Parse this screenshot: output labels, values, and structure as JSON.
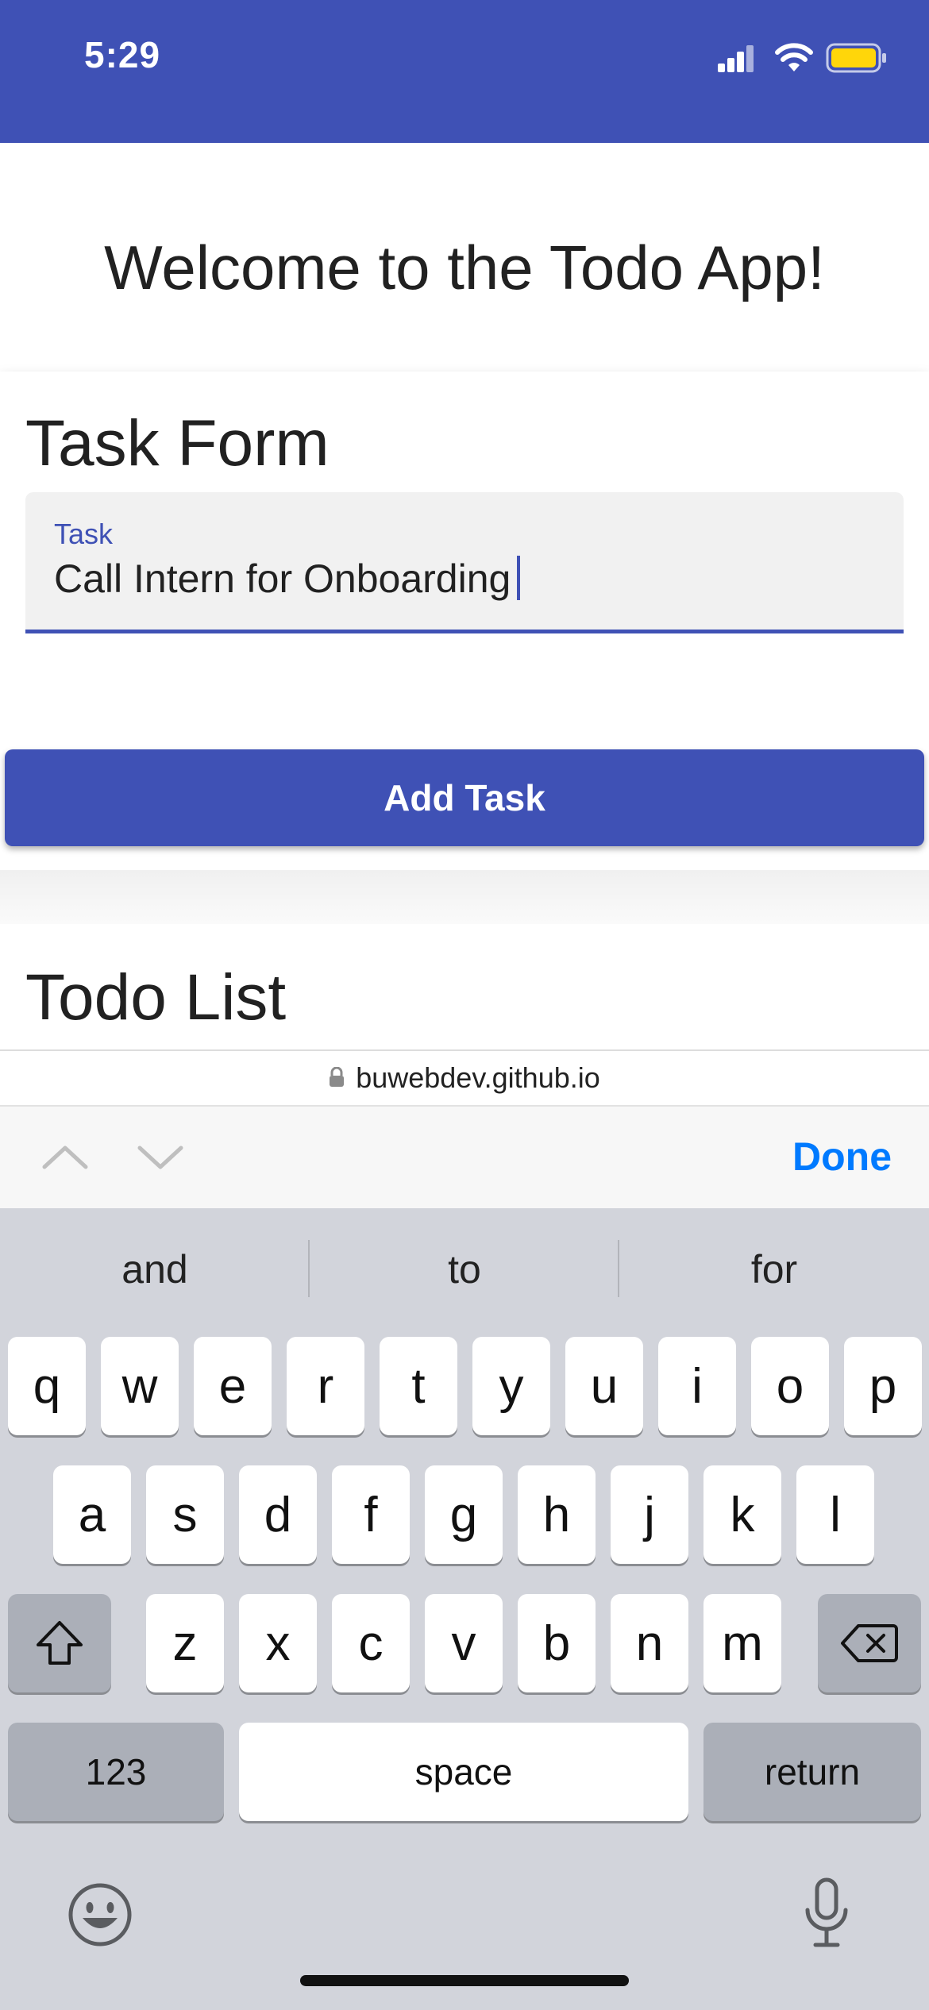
{
  "status_bar": {
    "time": "5:29"
  },
  "page": {
    "heading": "Welcome to the Todo App!",
    "task_form": {
      "title": "Task Form",
      "field_label": "Task",
      "field_value": "Call Intern for Onboarding",
      "submit_label": "Add Task"
    },
    "todo_list": {
      "title": "Todo List"
    }
  },
  "browser": {
    "url": "buwebdev.github.io"
  },
  "accessory": {
    "done_label": "Done"
  },
  "keyboard": {
    "suggestions": [
      "and",
      "to",
      "for"
    ],
    "row1": [
      "q",
      "w",
      "e",
      "r",
      "t",
      "y",
      "u",
      "i",
      "o",
      "p"
    ],
    "row2": [
      "a",
      "s",
      "d",
      "f",
      "g",
      "h",
      "j",
      "k",
      "l"
    ],
    "row3": [
      "z",
      "x",
      "c",
      "v",
      "b",
      "n",
      "m"
    ],
    "numbers_label": "123",
    "space_label": "space",
    "return_label": "return"
  },
  "colors": {
    "primary": "#3f51b5",
    "ios_blue": "#007aff",
    "keyboard_bg": "#d2d4db",
    "battery": "#ffd60a"
  },
  "icons": [
    "signal-icon",
    "wifi-icon",
    "battery-icon",
    "lock-icon",
    "chevron-up-icon",
    "chevron-down-icon",
    "shift-icon",
    "delete-icon",
    "emoji-icon",
    "microphone-icon"
  ]
}
